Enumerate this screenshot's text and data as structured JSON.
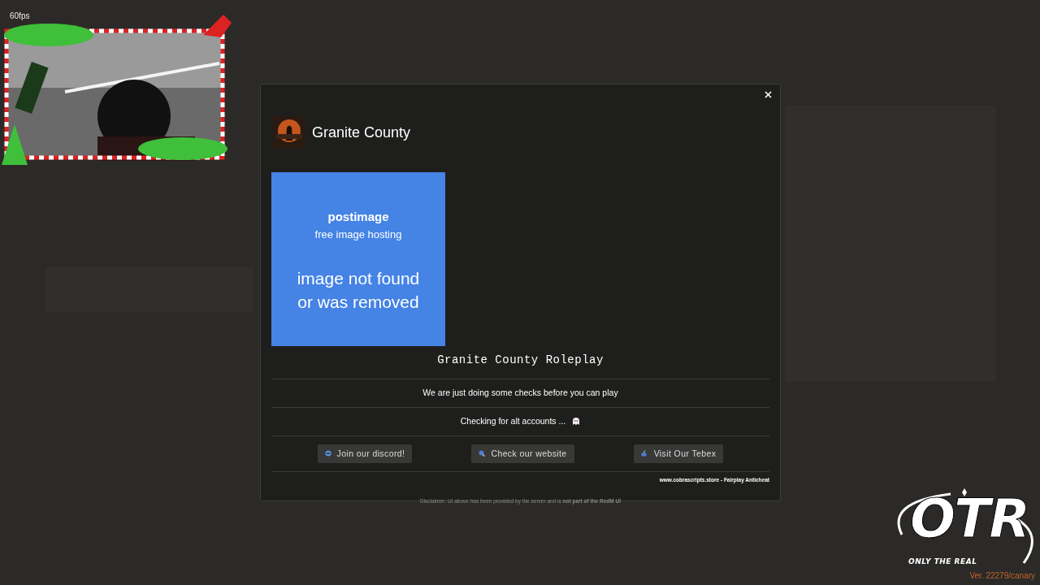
{
  "overlay": {
    "fps": "60fps"
  },
  "modal": {
    "title": "Granite County",
    "image": {
      "brand": "postimage",
      "tagline": "free image hosting",
      "message": "image not found or was removed"
    },
    "server_name": "Granite County Roleplay",
    "notice": "We are just doing some checks before you can play",
    "status": "Checking for alt accounts ...",
    "buttons": [
      {
        "label": "Join our discord!"
      },
      {
        "label": "Check our website"
      },
      {
        "label": "Visit Our Tebex"
      }
    ],
    "credit": "www.cobrascripts.store - Fairplay Anticheat",
    "disclaimer": "Disclaimer: UI above has been provided by the server and is **not part of the RedM UI**"
  },
  "brand_logo": {
    "letters": "OTR",
    "slogan": "ONLY THE REAL"
  },
  "version": "Ver. 22279/canary"
}
